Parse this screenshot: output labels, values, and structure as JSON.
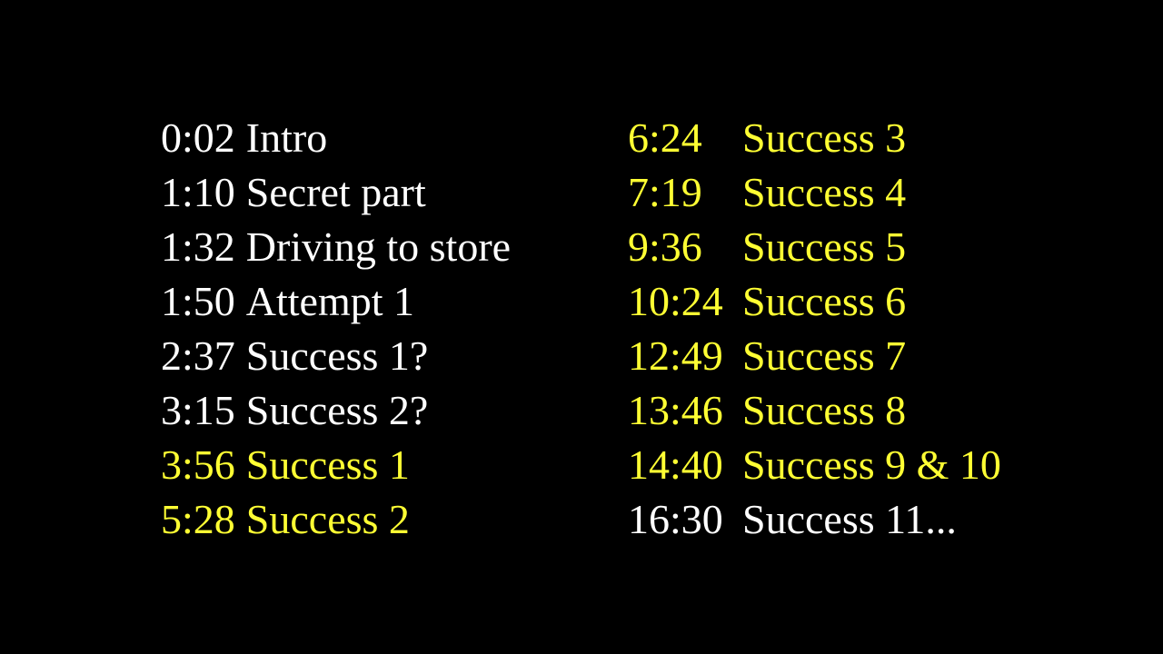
{
  "colors": {
    "background": "#000000",
    "white": "#ffffff",
    "yellow": "#ffff33"
  },
  "left_column": [
    {
      "time": "0:02",
      "label": "Intro",
      "color": "#ffffff"
    },
    {
      "time": "1:10",
      "label": "Secret part",
      "color": "#ffffff"
    },
    {
      "time": "1:32",
      "label": "Driving to store",
      "color": "#ffffff"
    },
    {
      "time": "1:50",
      "label": "Attempt 1",
      "color": "#ffffff"
    },
    {
      "time": "2:37",
      "label": "Success 1?",
      "color": "#ffffff"
    },
    {
      "time": "3:15",
      "label": "Success 2?",
      "color": "#ffffff"
    },
    {
      "time": "3:56",
      "label": "Success 1",
      "color": "#ffff33"
    },
    {
      "time": "5:28",
      "label": "Success 2",
      "color": "#ffff33"
    }
  ],
  "right_column": [
    {
      "time": "6:24",
      "label": "Success 3",
      "color": "#ffff33"
    },
    {
      "time": "7:19",
      "label": "Success 4",
      "color": "#ffff33"
    },
    {
      "time": "9:36",
      "label": "Success 5",
      "color": "#ffff33"
    },
    {
      "time": "10:24",
      "label": "Success 6",
      "color": "#ffff33"
    },
    {
      "time": "12:49",
      "label": "Success 7",
      "color": "#ffff33"
    },
    {
      "time": "13:46",
      "label": "Success 8",
      "color": "#ffff33"
    },
    {
      "time": "14:40",
      "label": "Success 9 & 10",
      "color": "#ffff33"
    },
    {
      "time": "16:30",
      "label": "Success 11...",
      "color": "#ffffff"
    }
  ]
}
